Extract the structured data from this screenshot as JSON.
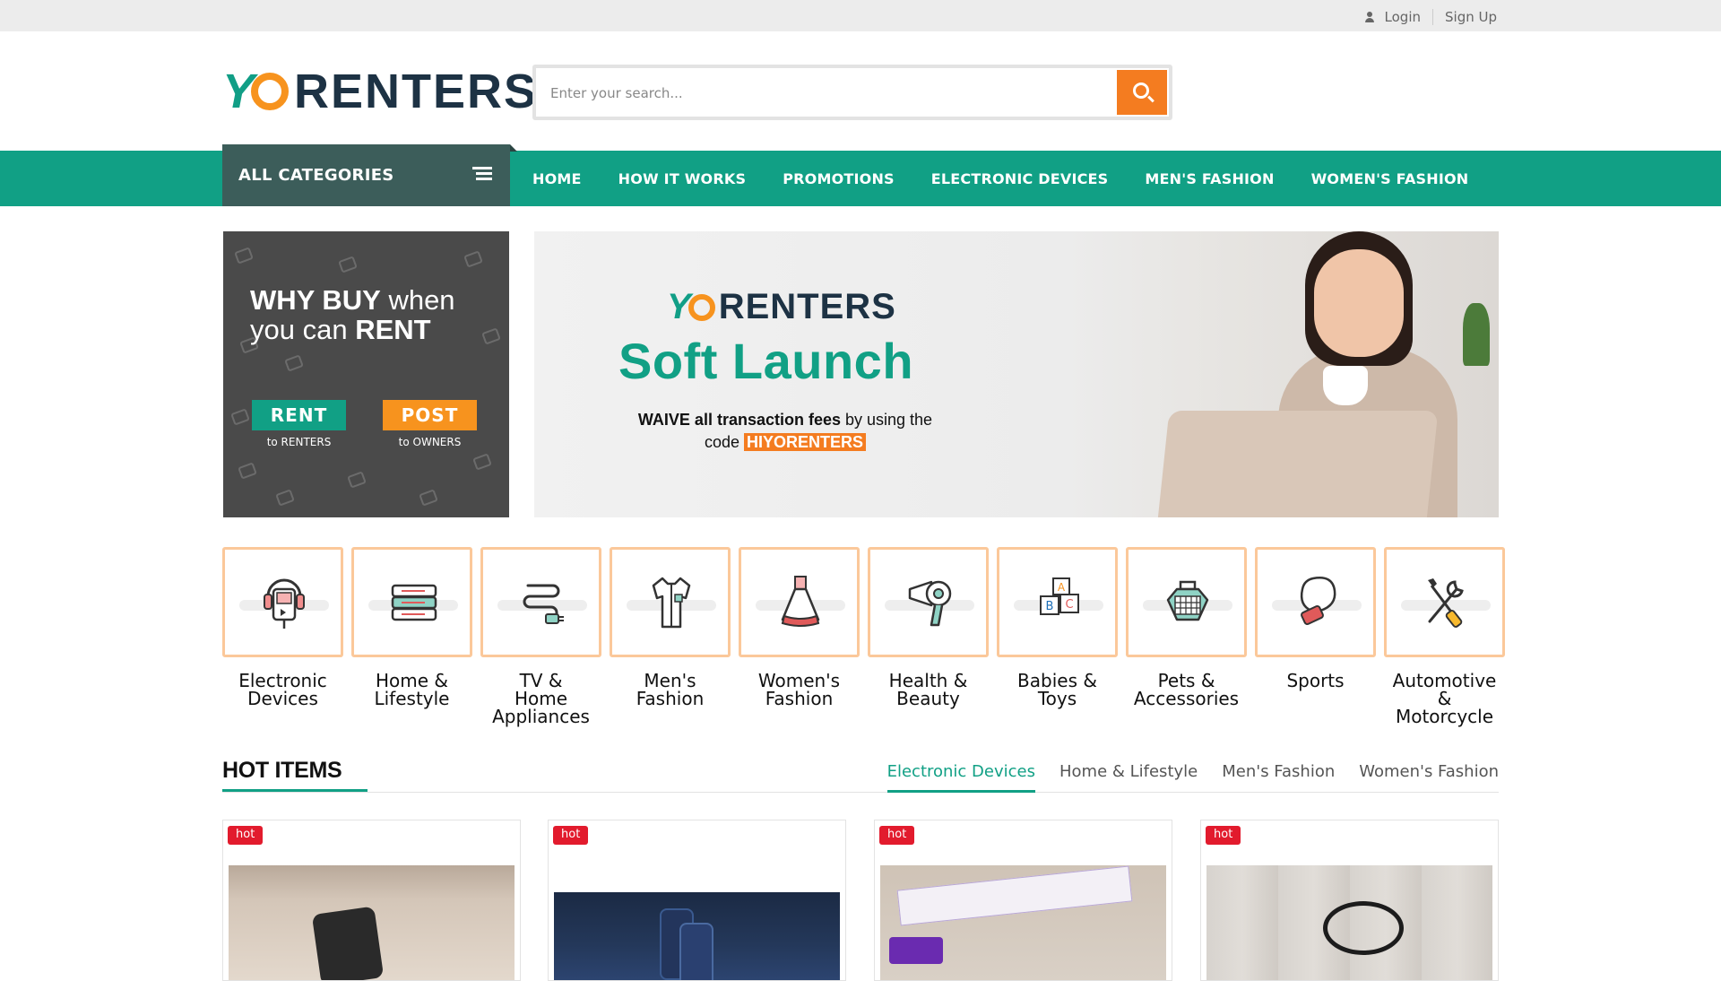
{
  "topbar": {
    "login": "Login",
    "signup": "Sign Up"
  },
  "header": {
    "logo_text": "RENTERS",
    "search_placeholder": "Enter your search..."
  },
  "nav": {
    "all_categories": "ALL CATEGORIES",
    "items": [
      "HOME",
      "HOW IT WORKS",
      "PROMOTIONS",
      "ELECTRONIC DEVICES",
      "MEN'S FASHION",
      "WOMEN'S FASHION"
    ]
  },
  "promo_left": {
    "line1_bold": "WHY BUY",
    "line1_rest": " when",
    "line2_rest": "you can ",
    "line2_bold": "RENT",
    "rent_label": "RENT",
    "rent_sub": "to RENTERS",
    "post_label": "POST",
    "post_sub": "to OWNERS"
  },
  "banner": {
    "logo_text": "RENTERS",
    "title": "Soft Launch",
    "waive_bold": "WAIVE all transaction fees",
    "waive_rest": " by using the",
    "code_prefix": "code ",
    "code": "HIYORENTERS"
  },
  "categories": [
    {
      "line1": "Electronic",
      "line2": "Devices",
      "line3": "",
      "icon": "media-player-icon"
    },
    {
      "line1": "Home &",
      "line2": "Lifestyle",
      "line3": "",
      "icon": "books-icon"
    },
    {
      "line1": "TV &",
      "line2": "Home",
      "line3": "Appliances",
      "icon": "plug-icon"
    },
    {
      "line1": "Men's",
      "line2": "Fashion",
      "line3": "",
      "icon": "shirt-icon"
    },
    {
      "line1": "Women's",
      "line2": "Fashion",
      "line3": "",
      "icon": "dress-icon"
    },
    {
      "line1": "Health &",
      "line2": "Beauty",
      "line3": "",
      "icon": "hair-dryer-icon"
    },
    {
      "line1": "Babies &",
      "line2": "Toys",
      "line3": "",
      "icon": "toy-blocks-icon"
    },
    {
      "line1": "Pets &",
      "line2": "Accessories",
      "line3": "",
      "icon": "pet-carrier-icon"
    },
    {
      "line1": "Sports",
      "line2": "",
      "line3": "",
      "icon": "boxing-glove-icon"
    },
    {
      "line1": "Automotive &",
      "line2": "Motorcycle",
      "line3": "",
      "icon": "tools-icon"
    }
  ],
  "hot_items": {
    "title": "HOT ITEMS",
    "tabs": [
      "Electronic Devices",
      "Home & Lifestyle",
      "Men's Fashion",
      "Women's Fashion"
    ],
    "active_tab": "Electronic Devices",
    "badge": "hot",
    "cards": [
      {
        "badge": "hot",
        "image": "action-camera-photo"
      },
      {
        "badge": "hot",
        "image": "smartphones-photo"
      },
      {
        "badge": "hot",
        "image": "hair-curling-iron-photo"
      },
      {
        "badge": "hot",
        "image": "cable-photo"
      }
    ]
  },
  "colors": {
    "brand_green": "#11a085",
    "brand_orange": "#f47c20",
    "brand_navy": "#1d3244",
    "hot_badge": "#e21b2d"
  }
}
